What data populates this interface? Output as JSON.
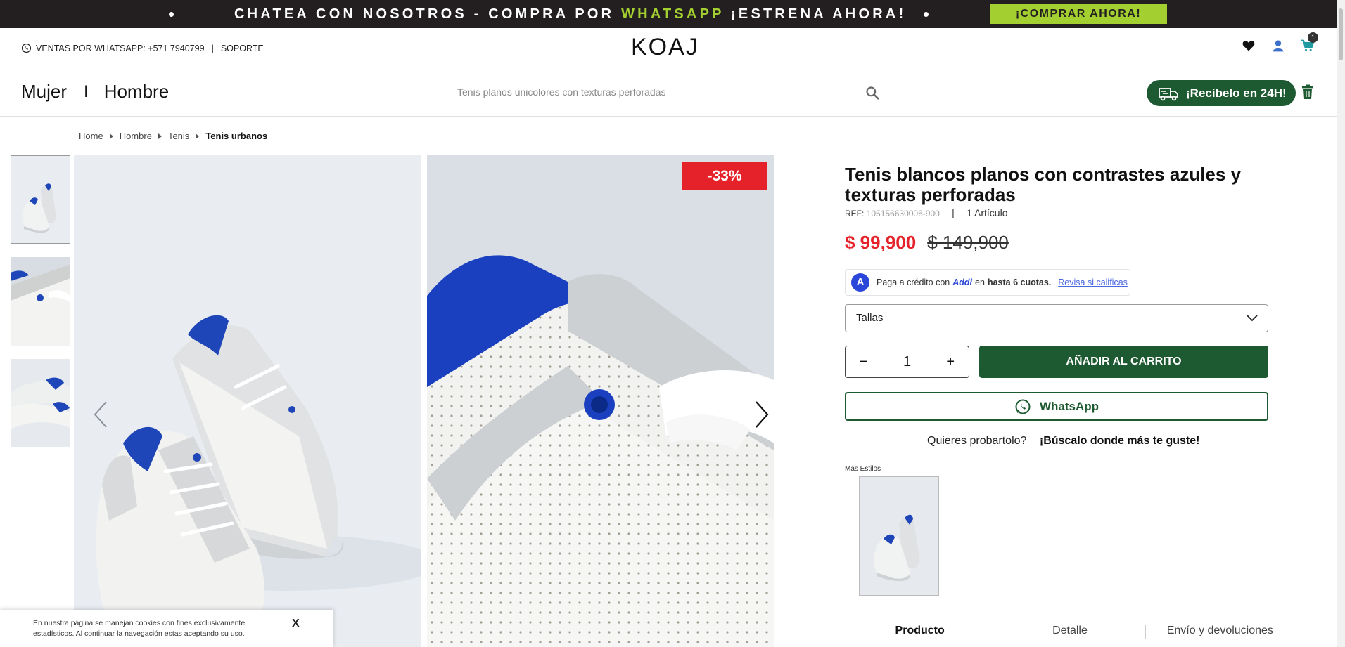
{
  "promo": {
    "message_prefix": "CHATEA CON NOSOTROS - COMPRA POR ",
    "message_highlight": "WHATSAPP",
    "message_suffix": " ¡ESTRENA AHORA!",
    "cta": "¡COMPRAR AHORA!",
    "bg_color": "#231f20",
    "accent_color": "#a3cf30"
  },
  "utility": {
    "whatsapp_label": "VENTAS POR WHATSAPP: +571 7940799",
    "separator": "|",
    "support": "SOPORTE"
  },
  "brand": {
    "logo": "KOAJ"
  },
  "header_icons": {
    "wishlist": "heart-icon",
    "account": "user-icon",
    "cart": "cart-icon",
    "cart_count": "1"
  },
  "nav": {
    "women": "Mujer",
    "separator": "I",
    "men": "Hombre"
  },
  "search": {
    "placeholder": "Tenis planos unicolores con texturas perforadas"
  },
  "delivery": {
    "label": "¡Recíbelo en 24H!",
    "color": "#1e5a31"
  },
  "breadcrumb": [
    "Home",
    "Hombre",
    "Tenis",
    "Tenis urbanos"
  ],
  "gallery": {
    "discount_badge": "-33%",
    "discount_color": "#e52229",
    "thumbnail_count": 3
  },
  "product": {
    "title": "Tenis blancos planos con contrastes azules y texturas perforadas",
    "ref_label": "REF:",
    "ref_value": "105156630006-900",
    "ref_separator": "|",
    "quantity_label": "1 Artículo",
    "price_now": "$ 99,900",
    "price_old": "$ 149,900",
    "price_color": "#e52229"
  },
  "addi": {
    "logo_letter": "A",
    "text_before": "Paga a crédito con",
    "brand": "Addi",
    "text_mid": "en",
    "bold": "hasta 6 cuotas.",
    "link": "Revisa si calificas"
  },
  "purchase": {
    "sizes_label": "Tallas",
    "qty_minus": "−",
    "qty_value": "1",
    "qty_plus": "+",
    "add_to_cart": "AÑADIR AL CARRITO",
    "whatsapp": "WhatsApp",
    "try_question": "Quieres probartolo?",
    "try_link": "¡Búscalo donde más te guste!",
    "button_color": "#1e5a31"
  },
  "styles": {
    "label": "Más Estilos"
  },
  "tabs": [
    "Producto",
    "Detalle",
    "Envío y devoluciones"
  ],
  "cookie": {
    "text": "En nuestra página se manejan cookies con fines exclusivamente estadísticos. Al continuar la navegación estas aceptando su uso.",
    "close": "X"
  }
}
